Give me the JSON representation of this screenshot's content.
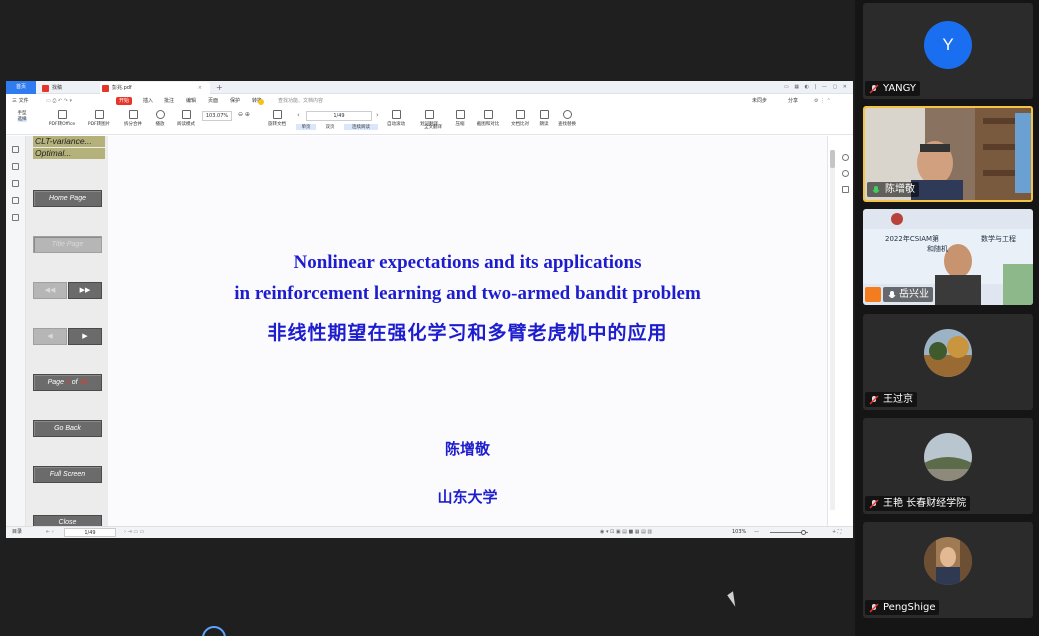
{
  "app": {
    "tabs": [
      {
        "label": "首页"
      },
      {
        "label": "找稿"
      },
      {
        "label": "彭兆.pdf"
      }
    ],
    "menu": [
      "三 文件",
      "开始",
      "插入",
      "批注",
      "编辑",
      "页面",
      "保护",
      "转换",
      "查找功能、文档内容"
    ],
    "menu_active": "开始",
    "menu_right": [
      "未同步",
      "分享"
    ],
    "toolbar": {
      "zoom_value": "103.07%",
      "page_value": "1/49",
      "items": [
        "手型",
        "选择",
        "PDF转Office",
        "PDF转图片",
        "拆分合并",
        "播放",
        "阅读模式",
        "旋转文档",
        "单页",
        "双页",
        "连续阅读",
        "自动滚动",
        "划词翻译",
        "全文翻译",
        "压缩",
        "截图和对比",
        "文档比对",
        "朗读",
        "查找替换"
      ]
    },
    "status": {
      "left": "目录",
      "page": "1/49",
      "zoom": "103%"
    }
  },
  "slide": {
    "toc": [
      "CLT-variance...",
      "Optimal..."
    ],
    "nav": {
      "home": "Home Page",
      "title": "Title Page",
      "prev_section": "◀◀",
      "next_section": "▶▶",
      "prev": "◀",
      "next": "▶",
      "page_prefix": "Page",
      "page_current": "1",
      "page_of": "of",
      "page_total": "49",
      "go_back": "Go Back",
      "full_screen": "Full Screen",
      "close": "Close"
    },
    "title_en_1": "Nonlinear expectations and its applications",
    "title_en_2": "in reinforcement learning and two-armed bandit problem",
    "title_cn": "非线性期望在强化学习和多臂老虎机中的应用",
    "author": "陈增敬",
    "institution": "山东大学"
  },
  "participants": [
    {
      "name": "YANGY",
      "avatar_letter": "Y",
      "type": "avatar"
    },
    {
      "name": "陈增敬",
      "type": "video",
      "speaking": true
    },
    {
      "name": "岳兴业",
      "type": "video"
    },
    {
      "name": "王过京",
      "type": "photo"
    },
    {
      "name": "王艳  长春财经学院",
      "type": "photo"
    },
    {
      "name": "PengShige",
      "type": "photo"
    }
  ],
  "participant_video_text": [
    "2022年CSIAM第",
    "数学与工程",
    "和随机"
  ],
  "colors": {
    "accent_blue": "#1d1dcf",
    "wps_red": "#e8352a",
    "tab_blue": "#2f7bf0",
    "speaking_border": "#f6c343",
    "beamer_btn": "#6b6b6b",
    "toc_olive": "#b5b17a"
  }
}
